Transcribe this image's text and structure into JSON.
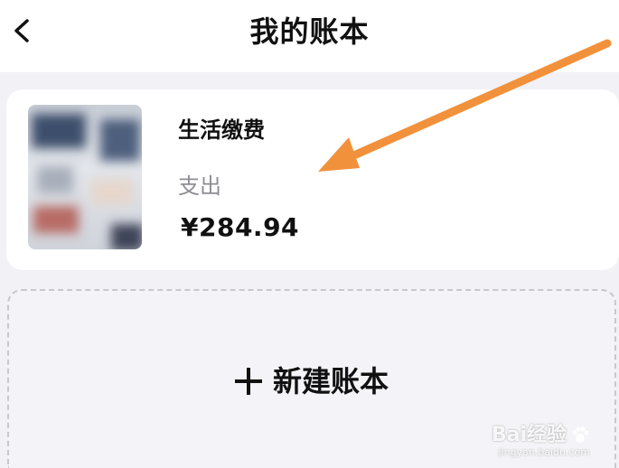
{
  "header": {
    "title": "我的账本",
    "back_icon": "chevron-left-icon"
  },
  "ledger": {
    "name": "生活缴费",
    "type": "支出",
    "amount": "¥284.94",
    "cover_icon": "blurred-cover-image"
  },
  "new_ledger": {
    "icon": "plus-icon",
    "label": "新建账本"
  },
  "annotation": {
    "icon": "orange-arrow-icon",
    "color": "#f2913c"
  },
  "watermark": {
    "logo_text": "Bai经验",
    "url": "jingyan.baidu.com",
    "icon": "paw-icon"
  },
  "colors": {
    "background": "#f1f1f6",
    "card": "#ffffff",
    "primary_text": "#111111",
    "secondary_text": "#8e8e93",
    "dashed_border": "#c7c7cc",
    "arrow": "#f2913c"
  }
}
